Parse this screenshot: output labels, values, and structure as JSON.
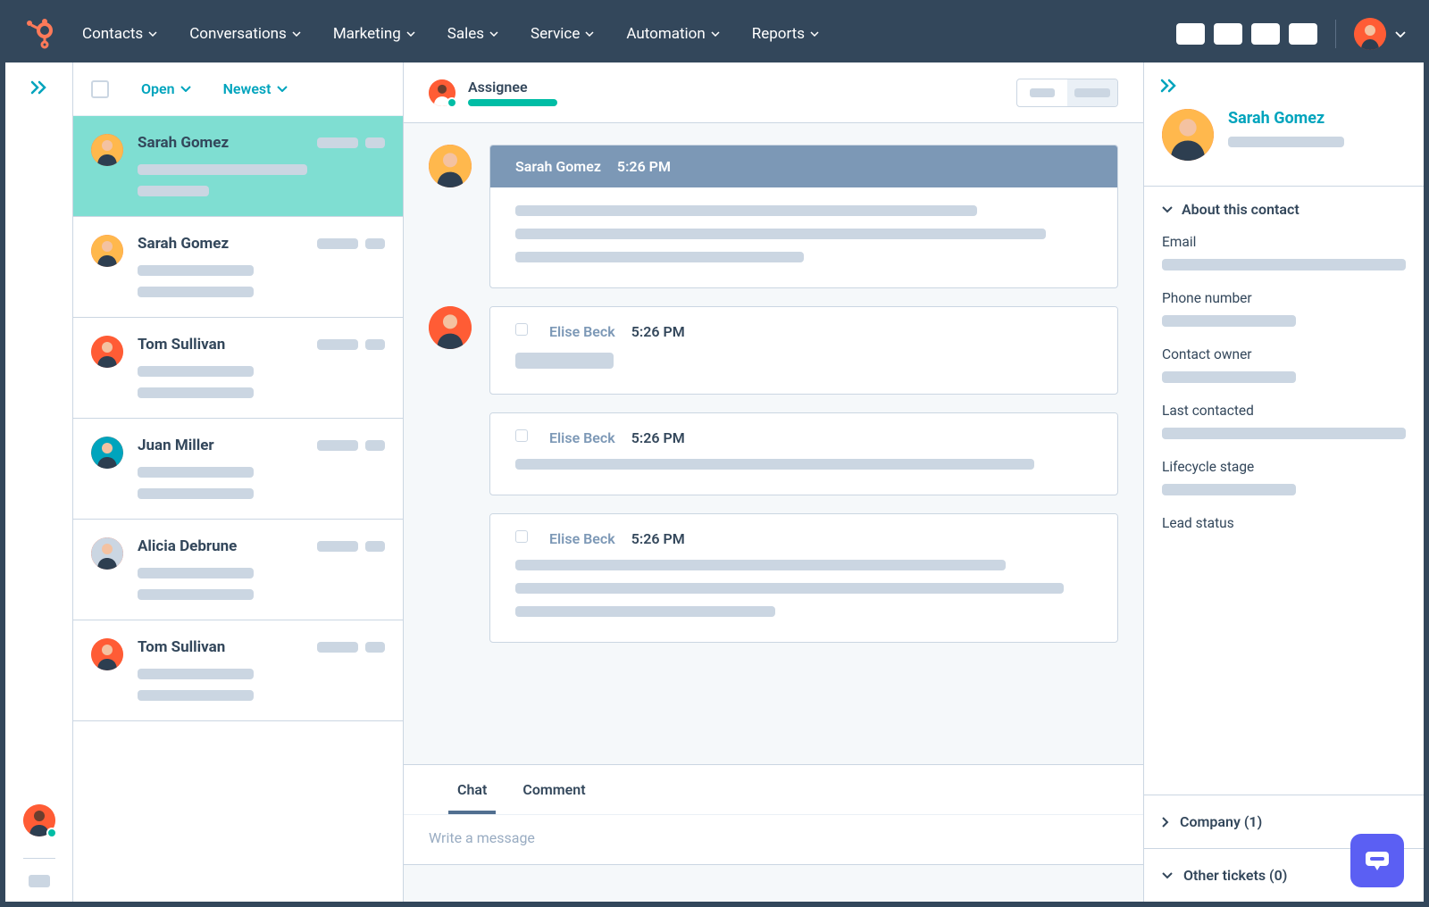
{
  "nav": {
    "items": [
      "Contacts",
      "Conversations",
      "Marketing",
      "Sales",
      "Service",
      "Automation",
      "Reports"
    ]
  },
  "inbox": {
    "filter_status": "Open",
    "filter_sort": "Newest",
    "conversations": [
      {
        "name": "Sarah Gomez",
        "color": "#ffb84d",
        "active": true
      },
      {
        "name": "Sarah Gomez",
        "color": "#ffb84d"
      },
      {
        "name": "Tom Sullivan",
        "color": "#ff5c35"
      },
      {
        "name": "Juan Miller",
        "color": "#00a4bd"
      },
      {
        "name": "Alicia Debrune",
        "color": "#cbd6e2"
      },
      {
        "name": "Tom Sullivan",
        "color": "#ff5c35"
      }
    ]
  },
  "thread": {
    "assignee_label": "Assignee",
    "messages": [
      {
        "sender": "Sarah Gomez",
        "time": "5:26 PM",
        "primary": true,
        "avatar": "#ffb84d"
      },
      {
        "sender": "Elise Beck",
        "time": "5:26 PM",
        "avatar": "#ff5c35"
      },
      {
        "sender": "Elise Beck",
        "time": "5:26 PM"
      },
      {
        "sender": "Elise Beck",
        "time": "5:26 PM"
      }
    ]
  },
  "composer": {
    "tabs": [
      "Chat",
      "Comment"
    ],
    "placeholder": "Write a message"
  },
  "right": {
    "contact_name": "Sarah Gomez",
    "about_title": "About this contact",
    "fields": [
      "Email",
      "Phone number",
      "Contact owner",
      "Last contacted",
      "Lifecycle stage",
      "Lead status"
    ],
    "company_label": "Company (1)",
    "tickets_label": "Other tickets (0)"
  }
}
